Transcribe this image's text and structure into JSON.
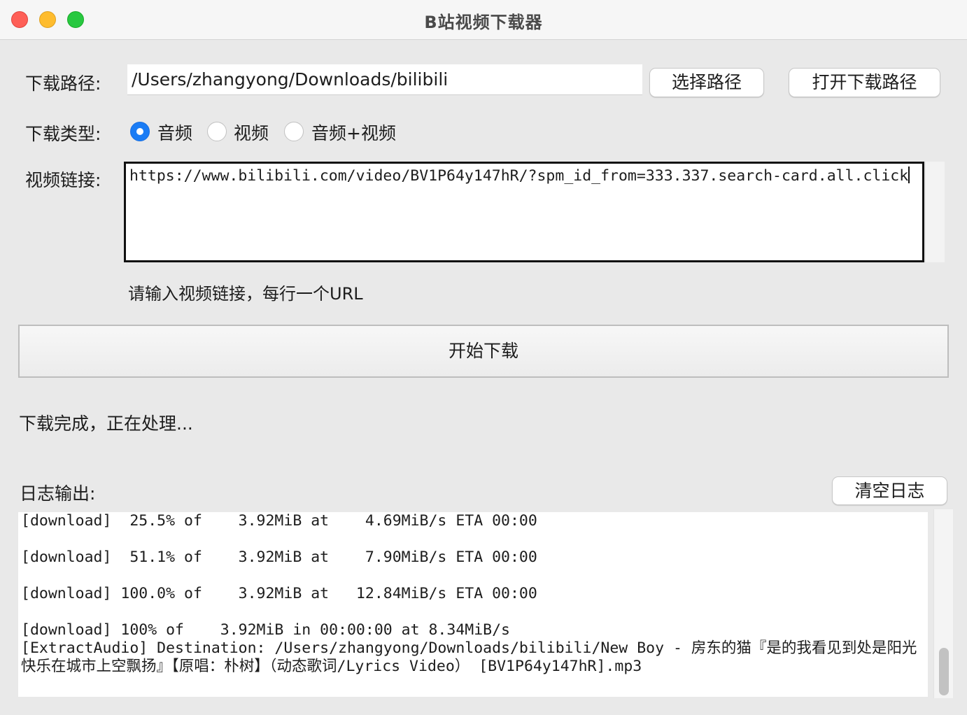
{
  "window": {
    "title": "B站视频下载器"
  },
  "download_path": {
    "label": "下载路径:",
    "value": "/Users/zhangyong/Downloads/bilibili",
    "choose_button": "选择路径",
    "open_button": "打开下载路径"
  },
  "download_type": {
    "label": "下载类型:",
    "options": [
      {
        "label": "音频",
        "selected": true
      },
      {
        "label": "视频",
        "selected": false
      },
      {
        "label": "音频+视频",
        "selected": false
      }
    ]
  },
  "video_link": {
    "label": "视频链接:",
    "value": "https://www.bilibili.com/video/BV1P64y147hR/?spm_id_from=333.337.search-card.all.click",
    "hint": "请输入视频链接，每行一个URL"
  },
  "start_button": "开始下载",
  "status_text": "下载完成，正在处理...",
  "log": {
    "label": "日志输出:",
    "clear_button": "清空日志",
    "lines": [
      "[download]  25.5% of    3.92MiB at    4.69MiB/s ETA 00:00",
      "",
      "[download]  51.1% of    3.92MiB at    7.90MiB/s ETA 00:00",
      "",
      "[download] 100.0% of    3.92MiB at   12.84MiB/s ETA 00:00",
      "",
      "[download] 100% of    3.92MiB in 00:00:00 at 8.34MiB/s",
      "[ExtractAudio] Destination: /Users/zhangyong/Downloads/bilibili/New Boy - 房东的猫『是的我看见到处是阳光 快乐在城市上空飘扬』【原唱：朴树】（动态歌词/Lyrics Video） [BV1P64y147hR].mp3"
    ]
  },
  "colors": {
    "accent": "#1a7cf5",
    "background": "#e9e9e9",
    "close": "#fe5f57",
    "minimize": "#febc2e",
    "maximize": "#28c840"
  }
}
